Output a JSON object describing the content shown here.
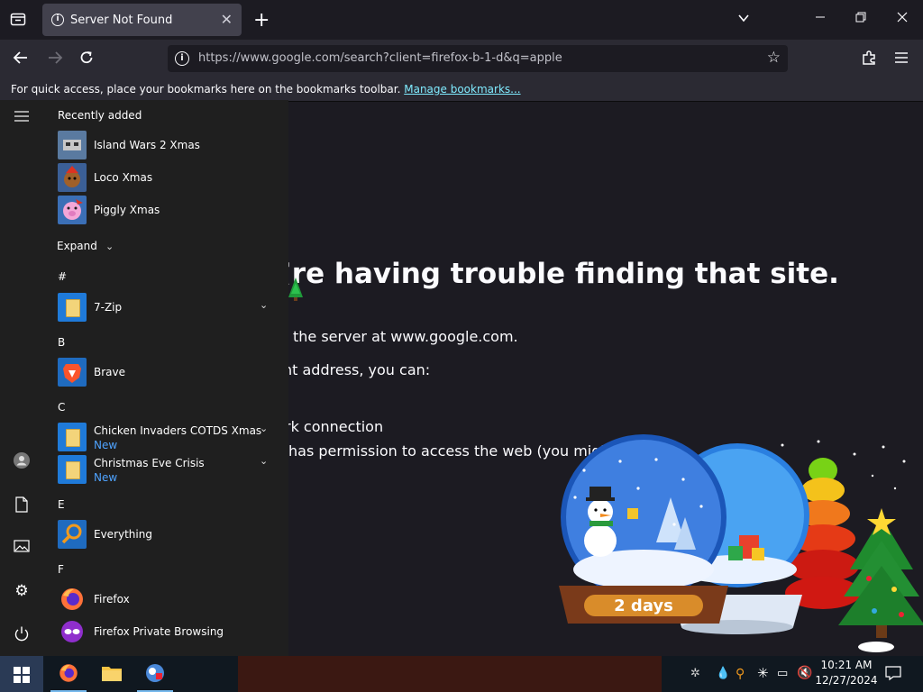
{
  "browser": {
    "tab_title": "Server Not Found",
    "url": "https://www.google.com/search?client=firefox-b-1-d&q=apple",
    "bookmarks_message": "For quick access, place your bookmarks here on the bookmarks toolbar.",
    "bookmarks_link": "Manage bookmarks..."
  },
  "error_page": {
    "title": "’re having trouble finding that site.",
    "line1": "the server at www.google.com.",
    "line2": "nt address, you can:",
    "line3": "rk connection",
    "line4": "has permission to access the web (you might be co"
  },
  "start_menu": {
    "recently_added_label": "Recently added",
    "recent": [
      {
        "label": "Island Wars 2 Xmas",
        "icon": "island-wars-icon"
      },
      {
        "label": "Loco Xmas",
        "icon": "loco-icon"
      },
      {
        "label": "Piggly Xmas",
        "icon": "piggly-icon"
      }
    ],
    "expand_label": "Expand",
    "groups": {
      "hash": "#",
      "b": "B",
      "c": "C",
      "e": "E",
      "f": "F"
    },
    "apps": {
      "zip": "7-Zip",
      "brave": "Brave",
      "chicken": "Chicken Invaders COTDS Xmas",
      "chicken_badge": "New",
      "christmas": "Christmas Eve Crisis",
      "christmas_badge": "New",
      "everything": "Everything",
      "firefox": "Firefox",
      "firefox_private": "Firefox Private Browsing"
    }
  },
  "widget": {
    "days_label": "2 days"
  },
  "taskbar": {
    "time": "10:21 AM",
    "date": "12/27/2024"
  },
  "colors": {
    "accent": "#80ebff",
    "new_badge": "#4fa3ff"
  }
}
